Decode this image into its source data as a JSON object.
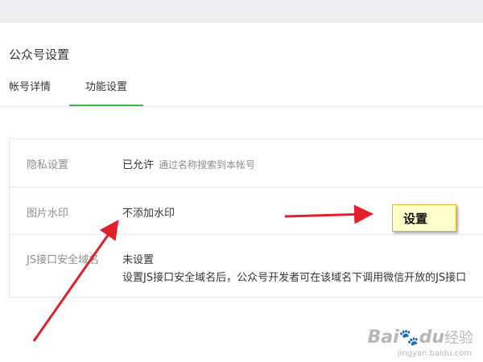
{
  "page": {
    "title": "公众号设置"
  },
  "tabs": [
    {
      "label": "帐号详情",
      "active": false
    },
    {
      "label": "功能设置",
      "active": true
    }
  ],
  "settings": [
    {
      "label": "隐私设置",
      "value": "已允许",
      "description": "通过名称搜索到本帐号"
    },
    {
      "label": "图片水印",
      "value": "不添加水印"
    },
    {
      "label": "JS接口安全域名",
      "value": "未设置",
      "description": "设置JS接口安全域名后，公众号开发者可在该域名下调用微信开放的JS接口"
    }
  ],
  "annotation": {
    "note": "设置",
    "note_bg": "#ffffcc",
    "arrow_color": "#e0202a"
  },
  "watermark": {
    "brand": "Bai",
    "brand_paw": "du",
    "jy": "经验",
    "url": "jingyan.baidu.com"
  },
  "colors": {
    "accent": "#44b549",
    "label": "#8d8d8d",
    "border": "#e7e7eb"
  }
}
